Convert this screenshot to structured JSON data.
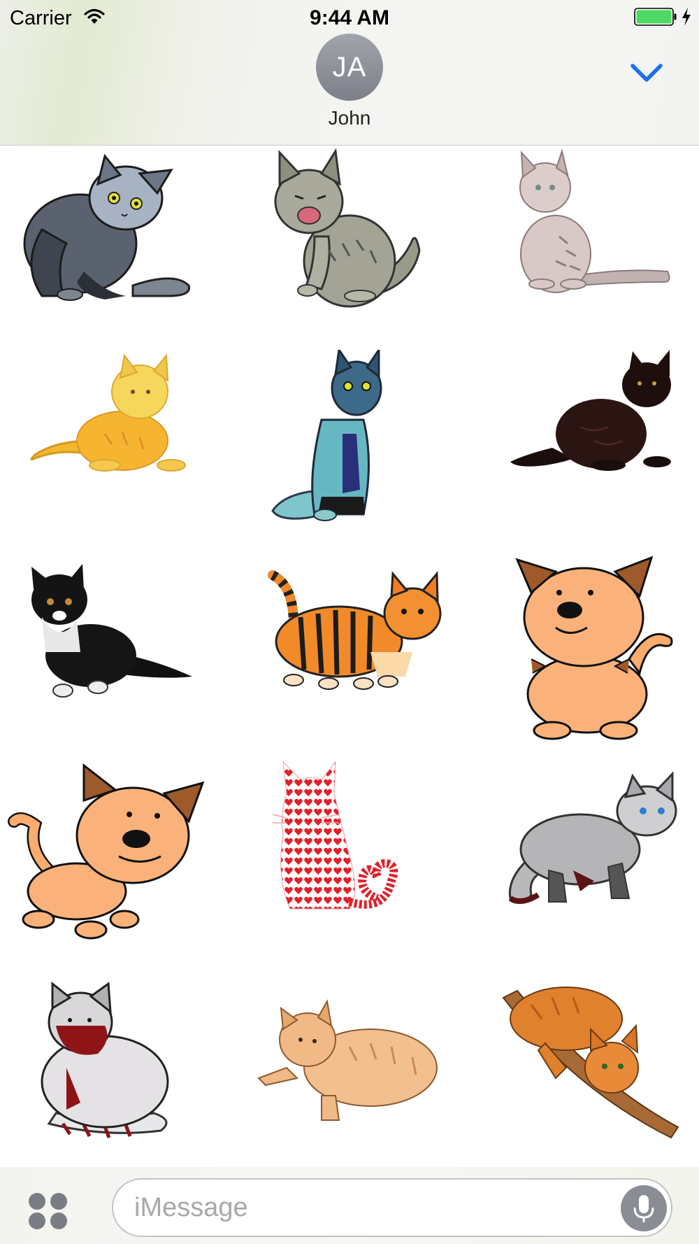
{
  "status_bar": {
    "carrier": "Carrier",
    "time": "9:44 AM",
    "battery_color": "#4cd964"
  },
  "header": {
    "avatar_initials": "JA",
    "contact_name": "John",
    "collapse_icon": "chevron-down-icon",
    "accent_color": "#1b6ff0"
  },
  "stickers": [
    {
      "name": "gray-cat-scratching",
      "icon": "cat-icon"
    },
    {
      "name": "tabby-cat-licking",
      "icon": "cat-icon"
    },
    {
      "name": "pale-tabby-kitten-sitting",
      "icon": "cat-icon"
    },
    {
      "name": "orange-cat-lying",
      "icon": "cat-icon"
    },
    {
      "name": "teal-cat-sitting",
      "icon": "cat-icon"
    },
    {
      "name": "black-fluffy-cat-lying",
      "icon": "cat-icon"
    },
    {
      "name": "black-white-kitten",
      "icon": "cat-icon"
    },
    {
      "name": "tiger-striped-kitten",
      "icon": "cat-icon"
    },
    {
      "name": "cartoon-cat-sitting",
      "icon": "cat-icon"
    },
    {
      "name": "cartoon-cat-walking",
      "icon": "cat-icon"
    },
    {
      "name": "heart-pattern-cat",
      "icon": "cat-icon"
    },
    {
      "name": "gray-cat-prowling",
      "icon": "cat-icon"
    },
    {
      "name": "red-white-cat-sitting",
      "icon": "cat-icon"
    },
    {
      "name": "ginger-cat-lying",
      "icon": "cat-icon"
    },
    {
      "name": "orange-cat-on-branch",
      "icon": "cat-icon"
    }
  ],
  "compose": {
    "placeholder": "iMessage",
    "apps_icon": "app-drawer-icon",
    "mic_icon": "microphone-icon"
  }
}
